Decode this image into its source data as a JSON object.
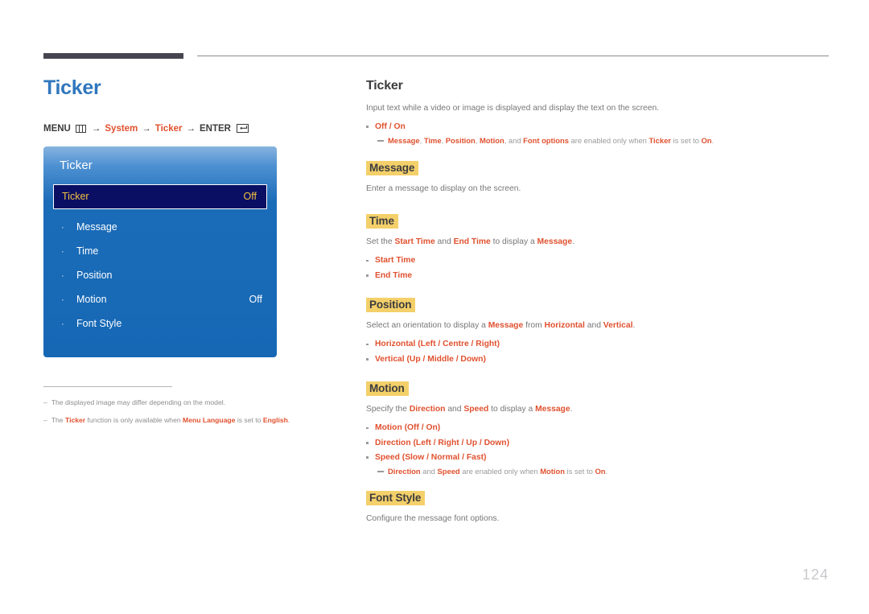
{
  "header": {
    "page_title": "Ticker",
    "menu_path": {
      "menu_label": "MENU",
      "menu_icon": "menu-grid-icon",
      "arrow": "→",
      "step1": "System",
      "step2": "Ticker",
      "enter_label": "ENTER",
      "enter_icon": "enter-return-icon"
    }
  },
  "osd": {
    "title": "Ticker",
    "rows": [
      {
        "label": "Ticker",
        "value": "Off",
        "selected": true,
        "bullet": ""
      },
      {
        "label": "Message",
        "value": "",
        "selected": false,
        "bullet": "·"
      },
      {
        "label": "Time",
        "value": "",
        "selected": false,
        "bullet": "·"
      },
      {
        "label": "Position",
        "value": "",
        "selected": false,
        "bullet": "·"
      },
      {
        "label": "Motion",
        "value": "Off",
        "selected": false,
        "bullet": "·"
      },
      {
        "label": "Font Style",
        "value": "",
        "selected": false,
        "bullet": "·"
      }
    ]
  },
  "notes": [
    {
      "dash": "–",
      "html": "The displayed image may differ depending on the model."
    },
    {
      "dash": "–",
      "html": "The <b>Ticker</b> function is only available when <b>Menu Language</b> is set to <b>English</b>."
    }
  ],
  "content": {
    "title": "Ticker",
    "intro": "Input text while a video or image is displayed and display the text on the screen.",
    "intro_bullet": "Off / On",
    "intro_note": "<b>Message</b>, <b>Time</b>, <b>Position</b>, <b>Motion</b>, and <b>Font options</b> are enabled only when <b>Ticker</b> is set to <b>On</b>.",
    "sections": [
      {
        "heading": "Message",
        "body": "Enter a message to display on the screen.",
        "bullets": [],
        "note": ""
      },
      {
        "heading": "Time",
        "body": "Set the <b>Start Time</b> and <b>End Time</b> to display a <b>Message</b>.",
        "bullets": [
          "Start Time",
          "End Time"
        ],
        "note": ""
      },
      {
        "heading": "Position",
        "body": "Select an orientation to display a <b>Message</b> from <b>Horizontal</b> and <b>Vertical</b>.",
        "bullets": [
          "Horizontal (Left / Centre / Right)",
          "Vertical (Up / Middle / Down)"
        ],
        "note": ""
      },
      {
        "heading": "Motion",
        "body": "Specify the <b>Direction</b> and <b>Speed</b> to display a <b>Message</b>.",
        "bullets": [
          "Motion (Off / On)",
          "Direction (Left / Right / Up / Down)",
          "Speed (Slow / Normal / Fast)"
        ],
        "note": "<b>Direction</b> and <b>Speed</b> are enabled only when <b>Motion</b> is set to <b>On</b>."
      },
      {
        "heading": "Font Style",
        "body": "Configure the message font options.",
        "bullets": [],
        "note": ""
      }
    ]
  },
  "footer": {
    "page_number": "124"
  },
  "colors": {
    "accent_orange": "#e0512f",
    "title_blue": "#3077bd",
    "highlight_yellow": "#f4d06a",
    "osd_blue": "#1b6cb8",
    "osd_selected_bg": "#0b0f63",
    "osd_selected_text": "#f3c13f"
  }
}
